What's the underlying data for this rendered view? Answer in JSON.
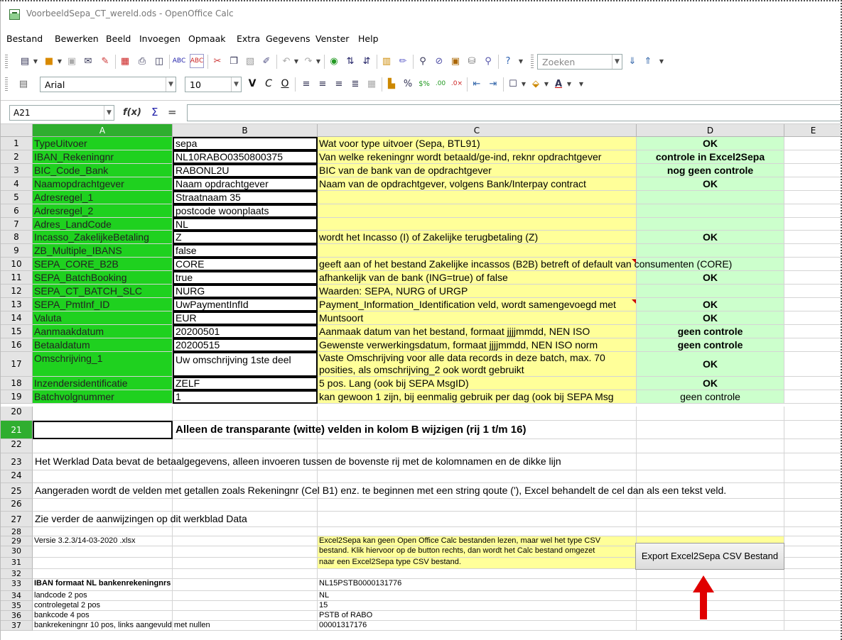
{
  "window": {
    "title": "VoorbeeldSepa_CT_wereld.ods - OpenOffice Calc"
  },
  "menu": [
    "Bestand",
    "Bewerken",
    "Beeld",
    "Invoegen",
    "Opmaak",
    "Extra",
    "Gegevens",
    "Venster",
    "Help"
  ],
  "toolbar": {
    "search_placeholder": "Zoeken",
    "font_name": "Arial",
    "font_size": "10",
    "bold_label": "V",
    "italic_label": "C",
    "underline_label": "O"
  },
  "formula_bar": {
    "cell_ref": "A21",
    "fx_icon": "f(x)",
    "sum_icon": "Σ",
    "equals_icon": "="
  },
  "columns": [
    "A",
    "B",
    "C",
    "D",
    "E"
  ],
  "rows": [
    {
      "n": "1",
      "a": "TypeUitvoer",
      "b": "sepa",
      "c": "Wat voor type uitvoer (Sepa, BTL91)",
      "d": "OK"
    },
    {
      "n": "2",
      "a": "IBAN_Rekeningnr",
      "b": "NL10RABO0350800375",
      "c": "Van welke rekeningnr wordt betaald/ge-ind, reknr opdrachtgever",
      "d": "controle in Excel2Sepa"
    },
    {
      "n": "3",
      "a": "BIC_Code_Bank",
      "b": "RABONL2U",
      "c": "BIC van de bank van de opdrachtgever",
      "d": "nog geen controle"
    },
    {
      "n": "4",
      "a": "Naamopdrachtgever",
      "b": "Naam opdrachtgever",
      "c": "Naam van de opdrachtgever, volgens Bank/Interpay contract",
      "d": "OK"
    },
    {
      "n": "5",
      "a": "Adresregel_1",
      "b": "Straatnaam 35",
      "c": "",
      "d": ""
    },
    {
      "n": "6",
      "a": "Adresregel_2",
      "b": "postcode woonplaats",
      "c": "",
      "d": ""
    },
    {
      "n": "7",
      "a": "Adres_LandCode",
      "b": "NL",
      "c": "",
      "d": ""
    },
    {
      "n": "8",
      "a": "Incasso_ZakelijkeBetaling",
      "b": "Z",
      "c": "wordt het Incasso (I) of Zakelijke terugbetaling (Z)",
      "d": "OK"
    },
    {
      "n": "9",
      "a": "ZB_Multiple_IBANS",
      "b": "false",
      "c": "",
      "d": ""
    },
    {
      "n": "10",
      "a": "SEPA_CORE_B2B",
      "b": "CORE",
      "c": "geeft aan of het bestand Zakelijke incassos (B2B) betreft of default van consumenten (CORE)",
      "d": ""
    },
    {
      "n": "11",
      "a": "SEPA_BatchBooking",
      "b": "true",
      "c": "afhankelijk van de bank (ING=true) of false",
      "d": "OK"
    },
    {
      "n": "12",
      "a": "SEPA_CT_BATCH_SLC",
      "b": "NURG",
      "c": "Waarden: SEPA, NURG of URGP",
      "d": ""
    },
    {
      "n": "13",
      "a": "SEPA_PmtInf_ID",
      "b": "UwPaymentInfId",
      "c": "Payment_Information_Identification veld, wordt samengevoegd met",
      "d": "OK"
    },
    {
      "n": "14",
      "a": "Valuta",
      "b": "EUR",
      "c": "Muntsoort",
      "d": "OK"
    },
    {
      "n": "15",
      "a": "Aanmaakdatum",
      "b": "20200501",
      "c": "Aanmaak datum van het bestand, formaat jjjjmmdd, NEN ISO",
      "d": "geen controle"
    },
    {
      "n": "16",
      "a": "Betaaldatum",
      "b": "20200515",
      "c": "Gewenste verwerkingsdatum,  formaat jjjjmmdd, NEN ISO norm",
      "d": "geen controle"
    },
    {
      "n": "17",
      "a": "Omschrijving_1",
      "b": "Uw omschrijving 1ste deel",
      "c": "Vaste Omschrijving voor alle data records in deze batch, max. 70 posities, als omschrijving_2 ook wordt gebruikt",
      "d": "OK"
    },
    {
      "n": "18",
      "a": "Inzendersidentificatie",
      "b": "ZELF",
      "c": " 5 pos. Lang (ook bij SEPA MsgID)",
      "d": "OK"
    },
    {
      "n": "19",
      "a": "Batchvolgnummer",
      "b": "1",
      "c": "kan gewoon 1 zijn, bij eenmalig gebruik per dag (ook bij SEPA Msg",
      "d": "geen controle"
    }
  ],
  "text_rows": {
    "r20": "20",
    "r21": "21",
    "r22": "22",
    "r23": "23",
    "r24": "24",
    "r25": "25",
    "r26": "26",
    "r27": "27",
    "r28": "28",
    "r29": "29",
    "r30": "30",
    "r31": "31",
    "r32": "32",
    "r33": "33",
    "r34": "34",
    "r35": "35",
    "r36": "36",
    "r37": "37",
    "t21": "Alleen de transparante (witte) velden in kolom B wijzigen (rij 1 t/m 16)",
    "t23": "Het Werklad Data bevat de betaalgegevens, alleen invoeren tussen de bovenste rij met de kolomnamen en de dikke lijn",
    "t25": "Aangeraden wordt de velden met getallen zoals Rekeningnr (Cel B1) enz. te beginnen met een string qoute ('), Excel behandelt de cel dan als een tekst veld.",
    "t27": "Zie verder de aanwijzingen op dit werkblad Data",
    "t29a": "Versie 3.2.3/14-03-2020 .xlsx",
    "t29c": "Excel2Sepa kan geen Open Office Calc bestanden lezen, maar wel het type CSV",
    "t30c": "bestand. Klik hiervoor op de button rechts, dan wordt het Calc bestand omgezet",
    "t31c": "naar een Excel2Sepa type CSV bestand.",
    "t33a": "IBAN formaat NL bankenrekeningnrs",
    "t33c": "NL15PSTB0000131776",
    "t34a": "landcode 2 pos",
    "t34c": "NL",
    "t35a": "controlegetal 2 pos",
    "t35c": "15",
    "t36a": "bankcode 4 pos",
    "t36c": "PSTB of RABO",
    "t37a": "bankrekeningnr 10 pos, links aangevuld met nullen",
    "t37c": "00001317176"
  },
  "export_button": "Export Excel2Sepa CSV Bestand",
  "colors": {
    "green": "#1fd11f",
    "yellow": "#ffff99",
    "light_green": "#ccffcc",
    "arrow": "#e00000"
  }
}
